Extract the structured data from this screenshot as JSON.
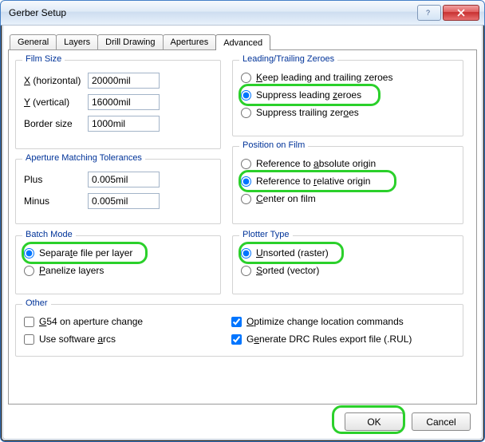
{
  "window": {
    "title": "Gerber Setup"
  },
  "tabs": [
    "General",
    "Layers",
    "Drill Drawing",
    "Apertures",
    "Advanced"
  ],
  "activeTab": "Advanced",
  "filmSize": {
    "legend": "Film Size",
    "x_label": "X (horizontal)",
    "x_value": "20000mil",
    "y_label": "Y (vertical)",
    "y_value": "16000mil",
    "border_label": "Border size",
    "border_value": "1000mil"
  },
  "apertureTol": {
    "legend": "Aperture Matching Tolerances",
    "plus_label": "Plus",
    "plus_value": "0.005mil",
    "minus_label": "Minus",
    "minus_value": "0.005mil"
  },
  "batch": {
    "legend": "Batch Mode",
    "opt1": "Separate file per layer",
    "opt2": "Panelize layers"
  },
  "other": {
    "legend": "Other",
    "g54": "G54 on aperture change",
    "arcs": "Use software arcs",
    "opt": "Optimize change location commands",
    "drc": "Generate DRC Rules export file (.RUL)"
  },
  "zeroes": {
    "legend": "Leading/Trailing Zeroes",
    "keep": "Keep leading and trailing zeroes",
    "sup_lead": "Suppress leading zeroes",
    "sup_trail": "Suppress trailing zeroes"
  },
  "position": {
    "legend": "Position on Film",
    "abs": "Reference to absolute origin",
    "rel": "Reference to relative origin",
    "center": "Center on film"
  },
  "plotter": {
    "legend": "Plotter Type",
    "unsorted": "Unsorted (raster)",
    "sorted": "Sorted (vector)"
  },
  "buttons": {
    "ok": "OK",
    "cancel": "Cancel"
  },
  "highlightColor": "#2bd02b"
}
